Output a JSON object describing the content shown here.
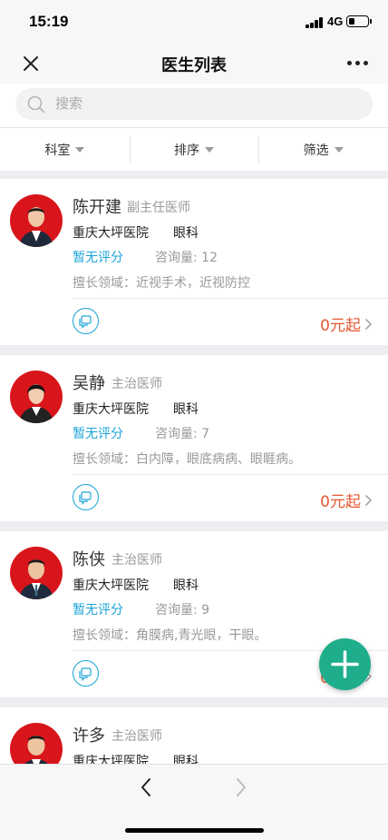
{
  "status_bar": {
    "time": "15:19",
    "network": "4G"
  },
  "nav": {
    "title": "医生列表"
  },
  "search": {
    "placeholder": "搜索"
  },
  "filters": [
    {
      "label": "科室"
    },
    {
      "label": "排序"
    },
    {
      "label": "筛选"
    }
  ],
  "doctors": [
    {
      "name": "陈开建",
      "title": "副主任医师",
      "hospital": "重庆大坪医院",
      "department": "眼科",
      "rating": "暂无评分",
      "consultations": "咨询量: 12",
      "specialty": "擅长领域：近视手术，近视防控",
      "price": "0元起"
    },
    {
      "name": "吴静",
      "title": "主治医师",
      "hospital": "重庆大坪医院",
      "department": "眼科",
      "rating": "暂无评分",
      "consultations": "咨询量: 7",
      "specialty": "擅长领域：白内障，眼底病病、眼睚病。",
      "price": "0元起"
    },
    {
      "name": "陈侠",
      "title": "主治医师",
      "hospital": "重庆大坪医院",
      "department": "眼科",
      "rating": "暂无评分",
      "consultations": "咨询量: 9",
      "specialty": "擅长领域：角膜病,青光眼，干眼。",
      "price": "0元起"
    },
    {
      "name": "许多",
      "title": "主治医师",
      "hospital": "重庆大坪医院",
      "department": "眼科"
    }
  ],
  "colors": {
    "accent_blue": "#1ba4d8",
    "price_orange": "#e4572e",
    "fab_green": "#1fae8c",
    "avatar_red": "#d9151c"
  },
  "icons": {
    "close": "close-icon",
    "more": "more-icon",
    "search": "search-icon",
    "chat": "chat-icon",
    "add": "plus-icon",
    "back": "chevron-left-icon",
    "forward": "chevron-right-icon"
  }
}
